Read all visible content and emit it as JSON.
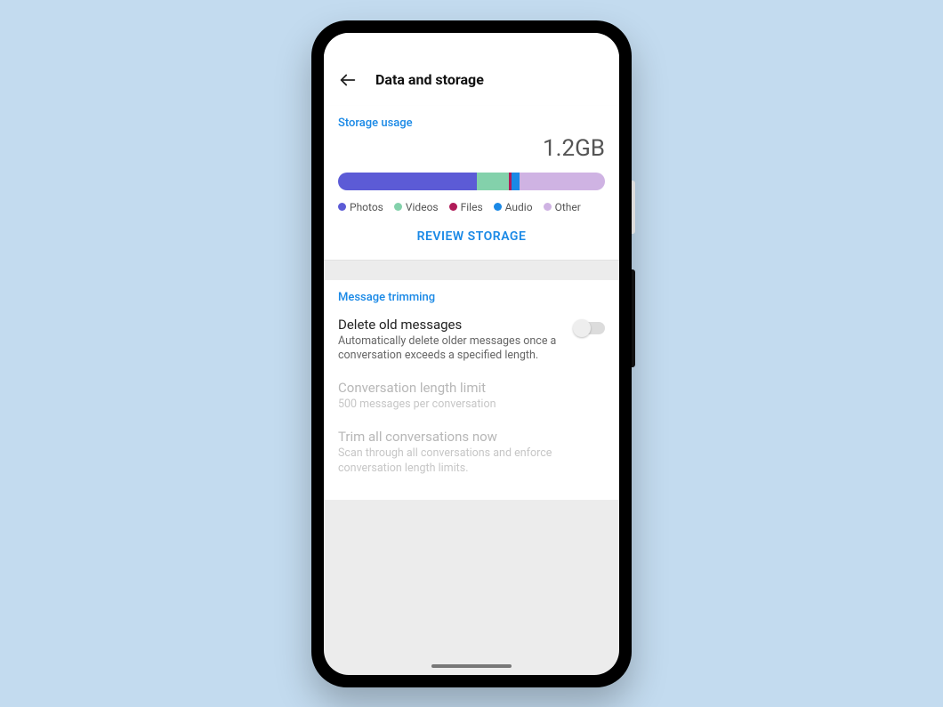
{
  "appbar": {
    "title": "Data and storage"
  },
  "storage": {
    "section_label": "Storage usage",
    "total": "1.2GB",
    "review_label": "REVIEW STORAGE",
    "segments": [
      {
        "name": "Photos",
        "color": "#5c5bd6",
        "percent": 52
      },
      {
        "name": "Videos",
        "color": "#83d1ab",
        "percent": 12
      },
      {
        "name": "Files",
        "color": "#b01b58",
        "percent": 1
      },
      {
        "name": "Audio",
        "color": "#1a89e6",
        "percent": 3
      },
      {
        "name": "Other",
        "color": "#cfb3e3",
        "percent": 32
      }
    ]
  },
  "trimming": {
    "section_label": "Message trimming",
    "delete_title": "Delete old messages",
    "delete_sub": "Automatically delete older messages once a conversation exceeds a specified length.",
    "delete_enabled": false,
    "limit_title": "Conversation length limit",
    "limit_sub": "500 messages per conversation",
    "trim_now_title": "Trim all conversations now",
    "trim_now_sub": "Scan through all conversations and enforce conversation length limits."
  }
}
